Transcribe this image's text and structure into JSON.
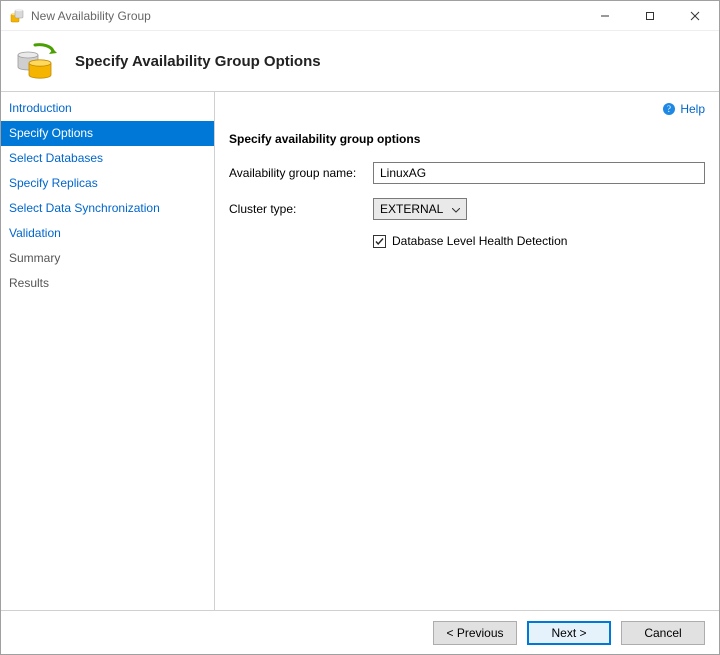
{
  "window": {
    "title": "New Availability Group",
    "minimize": "–",
    "maximize": "☐",
    "close": "✕"
  },
  "header": {
    "heading": "Specify Availability Group Options"
  },
  "help": {
    "label": "Help"
  },
  "sidebar": {
    "items": [
      {
        "label": "Introduction",
        "selected": false,
        "muted": false
      },
      {
        "label": "Specify Options",
        "selected": true,
        "muted": false
      },
      {
        "label": "Select Databases",
        "selected": false,
        "muted": false
      },
      {
        "label": "Specify Replicas",
        "selected": false,
        "muted": false
      },
      {
        "label": "Select Data Synchronization",
        "selected": false,
        "muted": false
      },
      {
        "label": "Validation",
        "selected": false,
        "muted": false
      },
      {
        "label": "Summary",
        "selected": false,
        "muted": true
      },
      {
        "label": "Results",
        "selected": false,
        "muted": true
      }
    ]
  },
  "form": {
    "section_title": "Specify availability group options",
    "ag_name_label": "Availability group name:",
    "ag_name_value": "LinuxAG",
    "cluster_type_label": "Cluster type:",
    "cluster_type_value": "EXTERNAL",
    "health_detection_checked": true,
    "health_detection_label": "Database Level Health Detection"
  },
  "footer": {
    "previous": "< Previous",
    "next": "Next >",
    "cancel": "Cancel"
  }
}
